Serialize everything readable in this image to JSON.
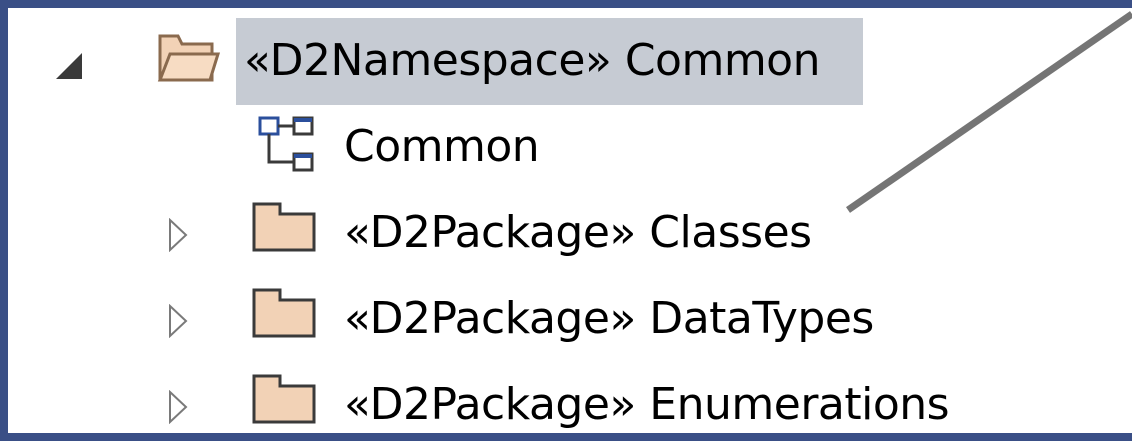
{
  "tree": {
    "root": {
      "label": "«D2Namespace» Common",
      "expanded": true,
      "selected": true,
      "icon": "open-folder-icon"
    },
    "children": [
      {
        "label": "Common",
        "icon": "diagram-icon",
        "expandable": false
      },
      {
        "label": "«D2Package» Classes",
        "icon": "package-folder-icon",
        "expandable": true
      },
      {
        "label": "«D2Package» DataTypes",
        "icon": "package-folder-icon",
        "expandable": true
      },
      {
        "label": "«D2Package» Enumerations",
        "icon": "package-folder-icon",
        "expandable": true
      }
    ]
  },
  "colors": {
    "frame": "#3a4f86",
    "selection": "#c6cbd3",
    "folder_fill": "#f2d2b6",
    "folder_stroke": "#8a6a4e",
    "connector": "#757575"
  }
}
